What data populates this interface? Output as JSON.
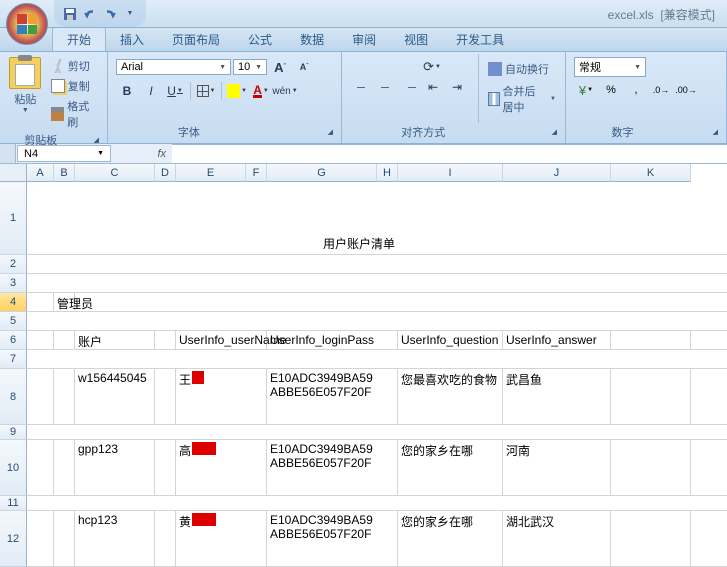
{
  "title": {
    "filename": "excel.xls",
    "mode": "[兼容模式]"
  },
  "tabs": {
    "home": "开始",
    "insert": "插入",
    "layout": "页面布局",
    "formula": "公式",
    "data": "数据",
    "review": "审阅",
    "view": "视图",
    "dev": "开发工具"
  },
  "ribbon": {
    "clipboard": {
      "paste": "粘贴",
      "cut": "剪切",
      "copy": "复制",
      "brush": "格式刷",
      "label": "剪贴板"
    },
    "font": {
      "name": "Arial",
      "size": "10",
      "grow": "A",
      "shrink": "A",
      "bold": "B",
      "italic": "I",
      "underline": "U",
      "fcolor": "A",
      "wen": "wén",
      "label": "字体"
    },
    "align": {
      "wrap": "自动换行",
      "merge": "合并后居中",
      "label": "对齐方式"
    },
    "number": {
      "format": "常规",
      "label": "数字"
    }
  },
  "namebox": "N4",
  "cols": {
    "A": "A",
    "B": "B",
    "C": "C",
    "D": "D",
    "E": "E",
    "F": "F",
    "G": "G",
    "H": "H",
    "I": "I",
    "J": "J",
    "K": "K"
  },
  "rows": {
    "r1": "1",
    "r2": "2",
    "r3": "3",
    "r4": "4",
    "r5": "5",
    "r6": "6",
    "r7": "7",
    "r8": "8",
    "r9": "9",
    "r10": "10",
    "r11": "11",
    "r12": "12"
  },
  "sheet": {
    "title": "用户账户清单",
    "admin": "管理员",
    "headers": {
      "account": "账户",
      "username": "UserInfo_userName",
      "password": "UserInfo_loginPass",
      "question": "UserInfo_question",
      "answer": "UserInfo_answer"
    },
    "rows": [
      {
        "account": "w156445045",
        "uname": "王",
        "pw1": "E10ADC3949BA59",
        "pw2": "ABBE56E057F20F",
        "q": "您最喜欢吃的食物",
        "a": "武昌鱼"
      },
      {
        "account": "gpp123",
        "uname": "高",
        "pw1": "E10ADC3949BA59",
        "pw2": "ABBE56E057F20F",
        "q": "您的家乡在哪",
        "a": "河南"
      },
      {
        "account": "hcp123",
        "uname": "黄",
        "pw1": "E10ADC3949BA59",
        "pw2": "ABBE56E057F20F",
        "q": "您的家乡在哪",
        "a": "湖北武汉"
      }
    ]
  }
}
